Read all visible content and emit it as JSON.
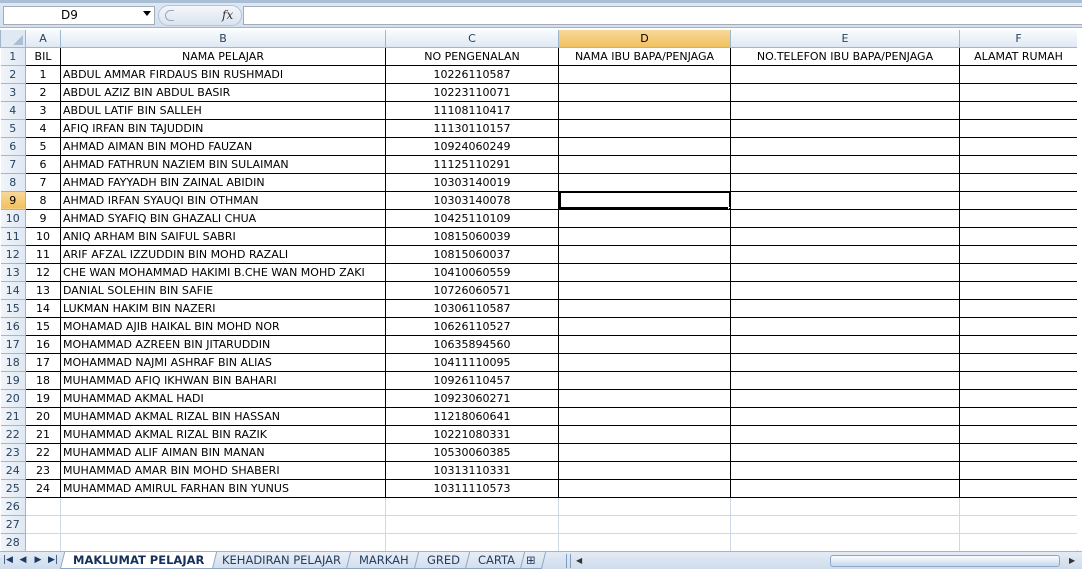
{
  "formula_bar": {
    "name_box_value": "D9",
    "fx_label": "fx",
    "formula_value": ""
  },
  "columns": [
    {
      "letter": "A"
    },
    {
      "letter": "B"
    },
    {
      "letter": "C"
    },
    {
      "letter": "D"
    },
    {
      "letter": "E"
    },
    {
      "letter": "F"
    }
  ],
  "selected_column": "D",
  "selected_row": 9,
  "headers": {
    "bil": "BIL",
    "nama": "NAMA PELAJAR",
    "no_pengenalan": "NO PENGENALAN",
    "nama_ibu_bapa": "NAMA IBU BAPA/PENJAGA",
    "no_telefon": "NO.TELEFON IBU BAPA/PENJAGA",
    "alamat": "ALAMAT RUMAH"
  },
  "students": [
    {
      "bil": "1",
      "nama": "ABDUL AMMAR FIRDAUS BIN RUSHMADI",
      "ic": "10226110587"
    },
    {
      "bil": "2",
      "nama": "ABDUL AZIZ BIN ABDUL BASIR",
      "ic": "10223110071"
    },
    {
      "bil": "3",
      "nama": "ABDUL LATIF BIN SALLEH",
      "ic": "11108110417"
    },
    {
      "bil": "4",
      "nama": "AFIQ IRFAN BIN TAJUDDIN",
      "ic": "11130110157"
    },
    {
      "bil": "5",
      "nama": "AHMAD AIMAN BIN MOHD FAUZAN",
      "ic": "10924060249"
    },
    {
      "bil": "6",
      "nama": "AHMAD FATHRUN NAZIEM BIN SULAIMAN",
      "ic": "11125110291"
    },
    {
      "bil": "7",
      "nama": "AHMAD FAYYADH BIN ZAINAL ABIDIN",
      "ic": "10303140019"
    },
    {
      "bil": "8",
      "nama": "AHMAD IRFAN SYAUQI BIN OTHMAN",
      "ic": "10303140078"
    },
    {
      "bil": "9",
      "nama": "AHMAD SYAFIQ BIN GHAZALI CHUA",
      "ic": "10425110109"
    },
    {
      "bil": "10",
      "nama": "ANIQ ARHAM BIN SAIFUL SABRI",
      "ic": "10815060039"
    },
    {
      "bil": "11",
      "nama": "ARIF AFZAL IZZUDDIN BIN MOHD RAZALI",
      "ic": "10815060037"
    },
    {
      "bil": "12",
      "nama": "CHE WAN MOHAMMAD HAKIMI B.CHE WAN MOHD ZAKI",
      "ic": "10410060559"
    },
    {
      "bil": "13",
      "nama": "DANIAL SOLEHIN BIN SAFIE",
      "ic": "10726060571"
    },
    {
      "bil": "14",
      "nama": "LUKMAN HAKIM BIN NAZERI",
      "ic": "10306110587"
    },
    {
      "bil": "15",
      "nama": "MOHAMAD AJIB HAIKAL BIN MOHD NOR",
      "ic": "10626110527"
    },
    {
      "bil": "16",
      "nama": "MOHAMMAD AZREEN BIN JITARUDDIN",
      "ic": "10635894560"
    },
    {
      "bil": "17",
      "nama": "MOHAMMAD NAJMI ASHRAF BIN ALIAS",
      "ic": "10411110095"
    },
    {
      "bil": "18",
      "nama": "MUHAMMAD AFIQ IKHWAN BIN BAHARI",
      "ic": "10926110457"
    },
    {
      "bil": "19",
      "nama": "MUHAMMAD AKMAL HADI",
      "ic": "10923060271"
    },
    {
      "bil": "20",
      "nama": "MUHAMMAD AKMAL RIZAL BIN HASSAN",
      "ic": "11218060641"
    },
    {
      "bil": "21",
      "nama": "MUHAMMAD AKMAL RIZAL BIN RAZIK",
      "ic": "10221080331"
    },
    {
      "bil": "22",
      "nama": "MUHAMMAD ALIF AIMAN BIN MANAN",
      "ic": "10530060385"
    },
    {
      "bil": "23",
      "nama": "MUHAMMAD AMAR BIN MOHD SHABERI",
      "ic": "10313110331"
    },
    {
      "bil": "24",
      "nama": "MUHAMMAD AMIRUL FARHAN BIN YUNUS",
      "ic": "10311110573"
    }
  ],
  "empty_rows": [
    "26",
    "27",
    "28"
  ],
  "sheet_tabs": [
    {
      "label": "MAKLUMAT PELAJAR",
      "active": true
    },
    {
      "label": "KEHADIRAN PELAJAR",
      "active": false
    },
    {
      "label": "MARKAH",
      "active": false
    },
    {
      "label": "GRED",
      "active": false
    },
    {
      "label": "CARTA",
      "active": false
    }
  ],
  "nav_buttons": [
    "first-sheet",
    "previous-sheet",
    "next-sheet",
    "last-sheet"
  ],
  "colors": {
    "header_bg": "#dfe8f3",
    "header_border": "#9eb6ce",
    "selected_header": "#f1c15f",
    "gridline": "#d0d7e5",
    "header_text": "#27415f"
  }
}
